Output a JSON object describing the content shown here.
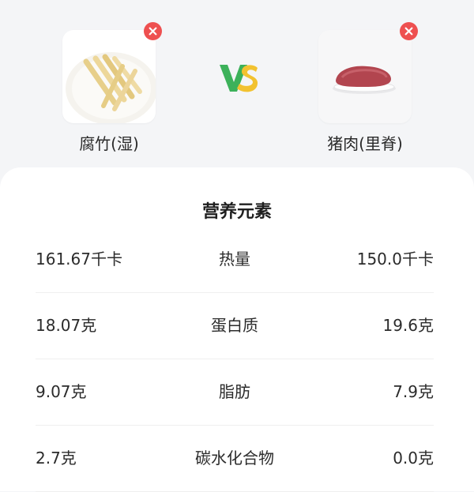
{
  "compare": {
    "left": {
      "name": "腐竹(湿)",
      "image": "tofu-skin-sticks-plate"
    },
    "right": {
      "name": "猪肉(里脊)",
      "image": "pork-tenderloin-plate"
    },
    "vs_label": "VS",
    "remove_icon": "close-icon"
  },
  "nutrients": {
    "title": "营养元素",
    "rows": [
      {
        "left": "161.67千卡",
        "name": "热量",
        "right": "150.0千卡"
      },
      {
        "left": "18.07克",
        "name": "蛋白质",
        "right": "19.6克"
      },
      {
        "left": "9.07克",
        "name": "脂肪",
        "right": "7.9克"
      },
      {
        "left": "2.7克",
        "name": "碳水化合物",
        "right": "0.0克"
      }
    ]
  },
  "colors": {
    "remove": "#ee5050",
    "vs_green": "#3cb15a",
    "vs_yellow": "#f2c230"
  }
}
